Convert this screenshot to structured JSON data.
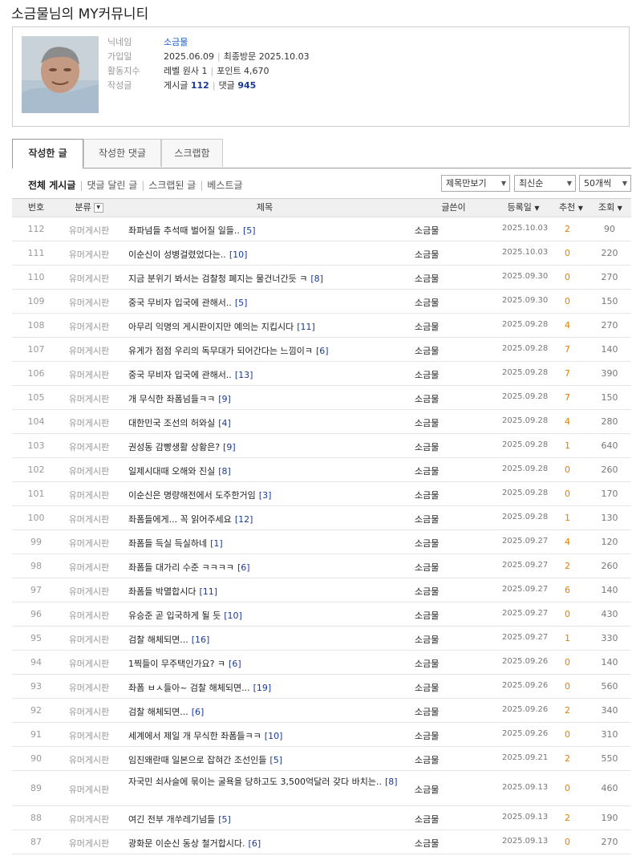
{
  "page_title": "소금물님의 MY커뮤니티",
  "profile": {
    "nickname_label": "닉네임",
    "nickname": "소금물",
    "joined_label": "가입일",
    "joined": "2025.06.09",
    "last_visit_label": "최종방문",
    "last_visit": "2025.10.03",
    "activity_label": "활동지수",
    "level": "레벨 원사 1",
    "points": "포인트 4,670",
    "posts_label": "작성글",
    "posts_text": "게시글",
    "posts_count": "112",
    "comments_text": "댓글",
    "comments_count": "945"
  },
  "tabs": [
    "작성한 글",
    "작성한 댓글",
    "스크랩함"
  ],
  "filters": [
    "전체 게시글",
    "댓글 달린 글",
    "스크랩된 글",
    "베스트글"
  ],
  "selects": {
    "view": "제목만보기",
    "sort": "최신순",
    "count": "50개씩"
  },
  "table_headers": {
    "no": "번호",
    "category": "분류",
    "title": "제목",
    "author": "글쓴이",
    "date": "등록일",
    "recommend": "추천",
    "views": "조회"
  },
  "posts": [
    {
      "no": "112",
      "category": "유머게시판",
      "title": "좌파넘들 추석때 벌어질 일들..",
      "comments": "[5]",
      "author": "소금물",
      "date": "2025.10.03",
      "recommend": "2",
      "views": "90"
    },
    {
      "no": "111",
      "category": "유머게시판",
      "title": "이순신이 성병걸렸었다는..",
      "comments": "[10]",
      "author": "소금물",
      "date": "2025.10.03",
      "recommend": "0",
      "views": "220"
    },
    {
      "no": "110",
      "category": "유머게시판",
      "title": "지금 분위기 봐서는 검찰청 폐지는 물건너간듯 ㅋ",
      "comments": "[8]",
      "author": "소금물",
      "date": "2025.09.30",
      "recommend": "0",
      "views": "270"
    },
    {
      "no": "109",
      "category": "유머게시판",
      "title": "중국 무비자 입국에 관해서..",
      "comments": "[5]",
      "author": "소금물",
      "date": "2025.09.30",
      "recommend": "0",
      "views": "150"
    },
    {
      "no": "108",
      "category": "유머게시판",
      "title": "아무리 익명의 게시판이지만 예의는 지킵시다",
      "comments": "[11]",
      "author": "소금물",
      "date": "2025.09.28",
      "recommend": "4",
      "views": "270"
    },
    {
      "no": "107",
      "category": "유머게시판",
      "title": "유게가 점점 우리의 독무대가 되어간다는 느낌이ㅋ",
      "comments": "[6]",
      "author": "소금물",
      "date": "2025.09.28",
      "recommend": "7",
      "views": "140"
    },
    {
      "no": "106",
      "category": "유머게시판",
      "title": "중국 무비자 입국에 관해서..",
      "comments": "[13]",
      "author": "소금물",
      "date": "2025.09.28",
      "recommend": "7",
      "views": "390"
    },
    {
      "no": "105",
      "category": "유머게시판",
      "title": "개 무식한 좌폼넘들ㅋㅋ",
      "comments": "[9]",
      "author": "소금물",
      "date": "2025.09.28",
      "recommend": "7",
      "views": "150"
    },
    {
      "no": "104",
      "category": "유머게시판",
      "title": "대한민국 조선의 허와실",
      "comments": "[4]",
      "author": "소금물",
      "date": "2025.09.28",
      "recommend": "4",
      "views": "280"
    },
    {
      "no": "103",
      "category": "유머게시판",
      "title": "권성동 감빵생활 상황은?",
      "comments": "[9]",
      "author": "소금물",
      "date": "2025.09.28",
      "recommend": "1",
      "views": "640"
    },
    {
      "no": "102",
      "category": "유머게시판",
      "title": "일제시대때 오해와 진실",
      "comments": "[8]",
      "author": "소금물",
      "date": "2025.09.28",
      "recommend": "0",
      "views": "260"
    },
    {
      "no": "101",
      "category": "유머게시판",
      "title": "이순신은 명량해전에서 도주한거임",
      "comments": "[3]",
      "author": "소금물",
      "date": "2025.09.28",
      "recommend": "0",
      "views": "170"
    },
    {
      "no": "100",
      "category": "유머게시판",
      "title": "좌폼들에게... 꼭 읽어주세요",
      "comments": "[12]",
      "author": "소금물",
      "date": "2025.09.28",
      "recommend": "1",
      "views": "130"
    },
    {
      "no": "99",
      "category": "유머게시판",
      "title": "좌폼들 득실 득실하네",
      "comments": "[1]",
      "author": "소금물",
      "date": "2025.09.27",
      "recommend": "4",
      "views": "120"
    },
    {
      "no": "98",
      "category": "유머게시판",
      "title": "좌폼들 대가리 수준 ㅋㅋㅋㅋ",
      "comments": "[6]",
      "author": "소금물",
      "date": "2025.09.27",
      "recommend": "2",
      "views": "260"
    },
    {
      "no": "97",
      "category": "유머게시판",
      "title": "좌폼들 박멸합시다",
      "comments": "[11]",
      "author": "소금물",
      "date": "2025.09.27",
      "recommend": "6",
      "views": "140"
    },
    {
      "no": "96",
      "category": "유머게시판",
      "title": "유승준 곧 입국하게 될 듯",
      "comments": "[10]",
      "author": "소금물",
      "date": "2025.09.27",
      "recommend": "0",
      "views": "430"
    },
    {
      "no": "95",
      "category": "유머게시판",
      "title": "검찰 해체되면...",
      "comments": "[16]",
      "author": "소금물",
      "date": "2025.09.27",
      "recommend": "1",
      "views": "330"
    },
    {
      "no": "94",
      "category": "유머게시판",
      "title": "1찍들이 무주택인가요? ㅋ",
      "comments": "[6]",
      "author": "소금물",
      "date": "2025.09.26",
      "recommend": "0",
      "views": "140"
    },
    {
      "no": "93",
      "category": "유머게시판",
      "title": "좌폼 ㅂㅅ들아~ 검찰 해체되면...",
      "comments": "[19]",
      "author": "소금물",
      "date": "2025.09.26",
      "recommend": "0",
      "views": "560"
    },
    {
      "no": "92",
      "category": "유머게시판",
      "title": "검찰 해체되면...",
      "comments": "[6]",
      "author": "소금물",
      "date": "2025.09.26",
      "recommend": "2",
      "views": "340"
    },
    {
      "no": "91",
      "category": "유머게시판",
      "title": "세계에서 제일 개 무식한 좌폼들ㅋㅋ",
      "comments": "[10]",
      "author": "소금물",
      "date": "2025.09.26",
      "recommend": "0",
      "views": "310"
    },
    {
      "no": "90",
      "category": "유머게시판",
      "title": "임진왜란때 일본으로 잡혀간 조선인들",
      "comments": "[5]",
      "author": "소금물",
      "date": "2025.09.21",
      "recommend": "2",
      "views": "550"
    },
    {
      "no": "89",
      "category": "유머게시판",
      "title": "자국민 쇠사슬에 묶이는 굴욕을 당하고도 3,500억달러 갖다 바치는..",
      "comments": "[8]",
      "author": "소금물",
      "date": "2025.09.13",
      "recommend": "0",
      "views": "460"
    },
    {
      "no": "88",
      "category": "유머게시판",
      "title": "여긴 전부 개쑤레기넘들",
      "comments": "[5]",
      "author": "소금물",
      "date": "2025.09.13",
      "recommend": "2",
      "views": "190"
    },
    {
      "no": "87",
      "category": "유머게시판",
      "title": "광화문 이순신 동상 철거합시다.",
      "comments": "[6]",
      "author": "소금물",
      "date": "2025.09.13",
      "recommend": "0",
      "views": "270"
    }
  ]
}
